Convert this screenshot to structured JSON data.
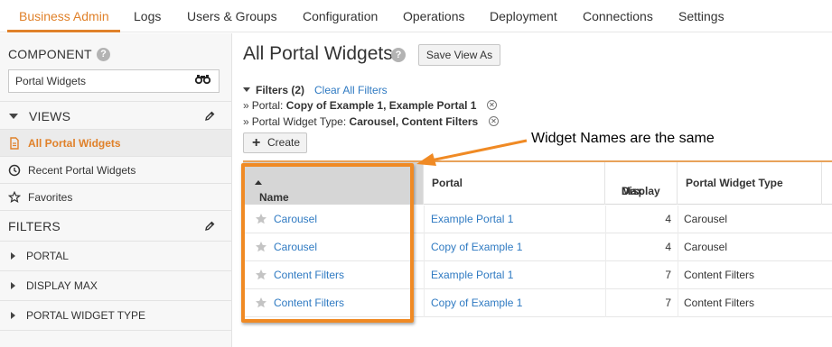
{
  "nav": {
    "tabs": [
      {
        "label": "Business Admin",
        "active": true
      },
      {
        "label": "Logs"
      },
      {
        "label": "Users & Groups"
      },
      {
        "label": "Configuration"
      },
      {
        "label": "Operations"
      },
      {
        "label": "Deployment"
      },
      {
        "label": "Connections"
      },
      {
        "label": "Settings"
      }
    ]
  },
  "sidebar": {
    "component_heading": "COMPONENT",
    "component_value": "Portal Widgets",
    "views_heading": "VIEWS",
    "views": [
      {
        "label": "All Portal Widgets",
        "icon": "document-icon",
        "active": true
      },
      {
        "label": "Recent Portal Widgets",
        "icon": "clock-icon"
      },
      {
        "label": "Favorites",
        "icon": "star-outline-icon"
      }
    ],
    "filters_heading": "FILTERS",
    "filter_groups": [
      {
        "label": "PORTAL"
      },
      {
        "label": "DISPLAY MAX"
      },
      {
        "label": "PORTAL WIDGET TYPE"
      }
    ]
  },
  "main": {
    "title": "All Portal Widgets",
    "save_view_label": "Save View As",
    "filters_title": "Filters (2)",
    "clear_filters_label": "Clear All Filters",
    "active_filters": [
      {
        "name": "Portal:",
        "values": "Copy of Example 1, Example Portal 1"
      },
      {
        "name": "Portal Widget Type:",
        "values": "Carousel, Content Filters"
      }
    ],
    "create_label": "Create",
    "annotation": "Widget Names are the same"
  },
  "grid": {
    "headers": {
      "name": "Name",
      "portal": "Portal",
      "display_max_line1": "Display",
      "display_max_line2": "Max",
      "type": "Portal Widget Type"
    },
    "rows": [
      {
        "name": "Carousel",
        "portal": "Example Portal 1",
        "display_max": "4",
        "type": "Carousel"
      },
      {
        "name": "Carousel",
        "portal": "Copy of Example 1",
        "display_max": "4",
        "type": "Carousel"
      },
      {
        "name": "Content Filters",
        "portal": "Example Portal 1",
        "display_max": "7",
        "type": "Content Filters"
      },
      {
        "name": "Content Filters",
        "portal": "Copy of Example 1",
        "display_max": "7",
        "type": "Content Filters"
      }
    ]
  },
  "colors": {
    "accent": "#e0812a",
    "link": "#2f7ac2",
    "highlight": "#f08a24"
  }
}
